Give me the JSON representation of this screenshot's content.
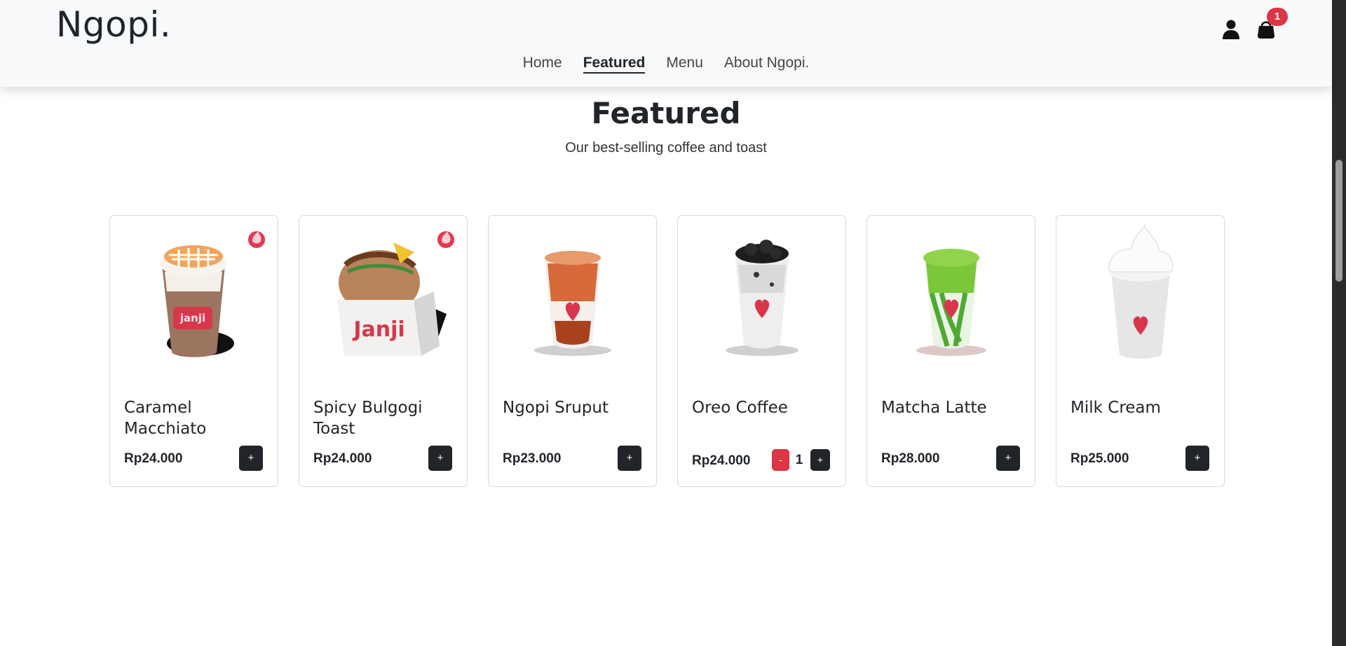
{
  "header": {
    "brand": "Ngopi.",
    "nav": [
      {
        "label": "Home",
        "active": false
      },
      {
        "label": "Featured",
        "active": true
      },
      {
        "label": "Menu",
        "active": false
      },
      {
        "label": "About Ngopi.",
        "active": false
      }
    ],
    "cart_count": "1",
    "icons": [
      "user-icon",
      "shopping-bag-icon"
    ]
  },
  "section": {
    "title": "Featured",
    "subtitle": "Our best-selling coffee and toast"
  },
  "products": [
    {
      "name": "Caramel Macchiato",
      "price": "Rp24.000",
      "add_label": "+",
      "hot": true,
      "image": "caramel-macchiato-image"
    },
    {
      "name": "Spicy Bulgogi Toast",
      "price": "Rp24.000",
      "add_label": "+",
      "hot": true,
      "image": "spicy-bulgogi-toast-image"
    },
    {
      "name": "Ngopi Sruput",
      "price": "Rp23.000",
      "add_label": "+",
      "hot": false,
      "image": "ngopi-sruput-image"
    },
    {
      "name": "Oreo Coffee",
      "price": "Rp24.000",
      "minus_label": "-",
      "quantity": "1",
      "plus_label": "+",
      "hot": false,
      "image": "oreo-coffee-image"
    },
    {
      "name": "Matcha Latte",
      "price": "Rp28.000",
      "add_label": "+",
      "hot": false,
      "image": "matcha-latte-image"
    },
    {
      "name": "Milk Cream",
      "price": "Rp25.000",
      "add_label": "+",
      "hot": false,
      "image": "milk-cream-image"
    }
  ],
  "colors": {
    "accent_red": "#dc3545",
    "dark": "#212529",
    "navbar_bg": "#f8f9fa"
  }
}
